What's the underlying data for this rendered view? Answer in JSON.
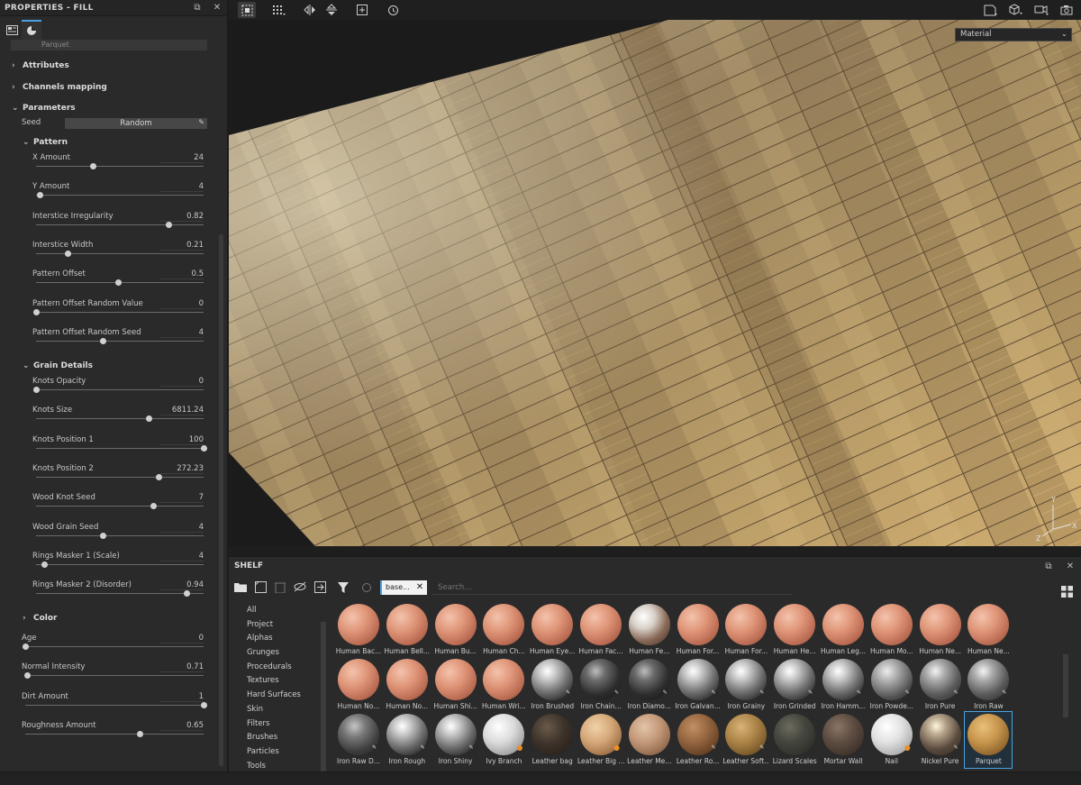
{
  "properties": {
    "title": "PROPERTIES - FILL",
    "preset_label": "Parquet",
    "sections": {
      "attributes": "Attributes",
      "channels": "Channels mapping",
      "parameters": "Parameters",
      "pattern": "Pattern",
      "grain": "Grain Details",
      "color": "Color"
    },
    "seed": {
      "label": "Seed",
      "value": "Random"
    },
    "pattern_params": [
      {
        "label": "X Amount",
        "value": "24",
        "pos": 0.34
      },
      {
        "label": "Y Amount",
        "value": "4",
        "pos": 0.02
      },
      {
        "label": "Interstice Irregularity",
        "value": "0.82",
        "pos": 0.79
      },
      {
        "label": "Interstice Width",
        "value": "0.21",
        "pos": 0.19
      },
      {
        "label": "Pattern Offset",
        "value": "0.5",
        "pos": 0.49
      },
      {
        "label": "Pattern Offset Random Value",
        "value": "0",
        "pos": 0.0
      },
      {
        "label": "Pattern Offset Random Seed",
        "value": "4",
        "pos": 0.4
      }
    ],
    "grain_params": [
      {
        "label": "Knots Opacity",
        "value": "0",
        "pos": 0.0
      },
      {
        "label": "Knots Size",
        "value": "6811.24",
        "pos": 0.67
      },
      {
        "label": "Knots Position 1",
        "value": "100",
        "pos": 1.0
      },
      {
        "label": "Knots Position 2",
        "value": "272.23",
        "pos": 0.73
      },
      {
        "label": "Wood Knot Seed",
        "value": "7",
        "pos": 0.7
      },
      {
        "label": "Wood Grain Seed",
        "value": "4",
        "pos": 0.4
      },
      {
        "label": "Rings Masker 1 (Scale)",
        "value": "4",
        "pos": 0.05
      },
      {
        "label": "Rings Masker 2 (Disorder)",
        "value": "0.94",
        "pos": 0.9
      }
    ],
    "global_params": [
      {
        "label": "Age",
        "value": "0",
        "pos": 0.0
      },
      {
        "label": "Normal Intensity",
        "value": "0.71",
        "pos": 0.01
      },
      {
        "label": "Dirt Amount",
        "value": "1",
        "pos": 1.0
      },
      {
        "label": "Roughness Amount",
        "value": "0.65",
        "pos": 0.64
      }
    ]
  },
  "viewport": {
    "mode": "Material"
  },
  "shelf": {
    "title": "SHELF",
    "filter_tag": "base...",
    "search_placeholder": "Search...",
    "categories": [
      "All",
      "Project",
      "Alphas",
      "Grunges",
      "Procedurals",
      "Textures",
      "Hard Surfaces",
      "Skin",
      "Filters",
      "Brushes",
      "Particles",
      "Tools"
    ],
    "materials": [
      {
        "name": "Human Bac...",
        "style": "skin"
      },
      {
        "name": "Human Bell...",
        "style": "skin"
      },
      {
        "name": "Human Bu...",
        "style": "skin"
      },
      {
        "name": "Human Ch...",
        "style": "skin"
      },
      {
        "name": "Human Eye...",
        "style": "skin"
      },
      {
        "name": "Human Fac...",
        "style": "skin"
      },
      {
        "name": "Human Fe...",
        "style": "skinw"
      },
      {
        "name": "Human For...",
        "style": "skin"
      },
      {
        "name": "Human For...",
        "style": "skin"
      },
      {
        "name": "Human He...",
        "style": "skin"
      },
      {
        "name": "Human Leg...",
        "style": "skin"
      },
      {
        "name": "Human Mo...",
        "style": "skin"
      },
      {
        "name": "Human Ne...",
        "style": "skin"
      },
      {
        "name": "Human Ne...",
        "style": "skin"
      },
      {
        "name": "Human No...",
        "style": "skin"
      },
      {
        "name": "Human No...",
        "style": "skin"
      },
      {
        "name": "Human Shi...",
        "style": "skin"
      },
      {
        "name": "Human Wri...",
        "style": "skin"
      },
      {
        "name": "Iron Brushed",
        "style": "iron",
        "badge": "true"
      },
      {
        "name": "Iron Chain...",
        "style": "ironD",
        "badge": "true"
      },
      {
        "name": "Iron Diamo...",
        "style": "ironD",
        "badge": "true"
      },
      {
        "name": "Iron Galvan...",
        "style": "iron",
        "badge": "true"
      },
      {
        "name": "Iron Grainy",
        "style": "iron",
        "badge": "true"
      },
      {
        "name": "Iron Grinded",
        "style": "iron",
        "badge": "true"
      },
      {
        "name": "Iron Hamm...",
        "style": "iron",
        "badge": "true"
      },
      {
        "name": "Iron Powde...",
        "style": "ironP",
        "badge": "true"
      },
      {
        "name": "Iron Pure",
        "style": "ironR",
        "badge": "true"
      },
      {
        "name": "Iron Raw",
        "style": "ironR",
        "badge": "true"
      },
      {
        "name": "Iron Raw D...",
        "style": "ironRaw",
        "badge": "true"
      },
      {
        "name": "Iron Rough",
        "style": "iron",
        "badge": "true"
      },
      {
        "name": "Iron Shiny",
        "style": "iron",
        "badge": "true"
      },
      {
        "name": "Ivy Branch",
        "style": "ivy",
        "badge": "orange"
      },
      {
        "name": "Leather bag",
        "style": "lbag"
      },
      {
        "name": "Leather Big ...",
        "style": "lbig",
        "badge": "orange"
      },
      {
        "name": "Leather Me...",
        "style": "lme"
      },
      {
        "name": "Leather Ro...",
        "style": "lro",
        "badge": "true"
      },
      {
        "name": "Leather Soft...",
        "style": "lsof",
        "badge": "true"
      },
      {
        "name": "Lizard Scales",
        "style": "liz"
      },
      {
        "name": "Mortar Wall",
        "style": "mor"
      },
      {
        "name": "Nail",
        "style": "nail",
        "badge": "orange"
      },
      {
        "name": "Nickel Pure",
        "style": "nick",
        "badge": "true"
      },
      {
        "name": "Parquet",
        "style": "parq",
        "selected": "true"
      }
    ]
  }
}
